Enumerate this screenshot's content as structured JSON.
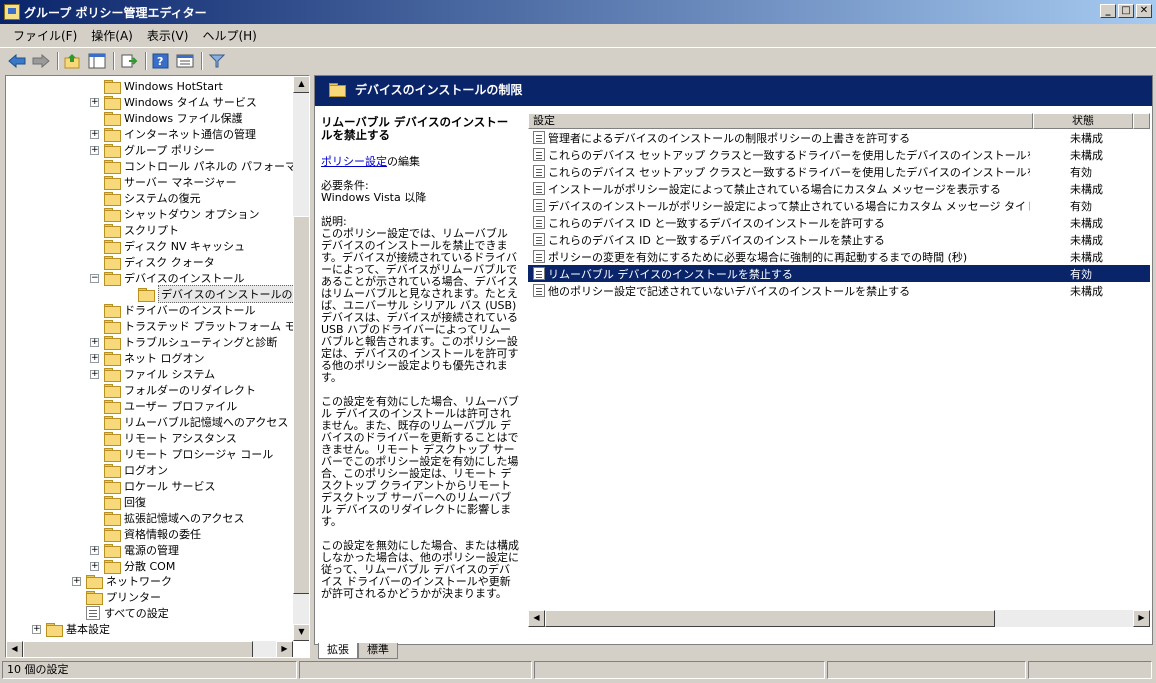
{
  "window": {
    "title": "グループ ポリシー管理エディター",
    "controls": [
      "_",
      "□",
      "✕"
    ]
  },
  "menu": [
    "ファイル(F)",
    "操作(A)",
    "表示(V)",
    "ヘルプ(H)"
  ],
  "tree": {
    "items": [
      {
        "label": "Windows HotStart",
        "expander": ""
      },
      {
        "label": "Windows タイム サービス",
        "expander": "+"
      },
      {
        "label": "Windows ファイル保護",
        "expander": ""
      },
      {
        "label": "インターネット通信の管理",
        "expander": "+"
      },
      {
        "label": "グループ ポリシー",
        "expander": "+"
      },
      {
        "label": "コントロール パネルの パフォーマンス",
        "expander": ""
      },
      {
        "label": "サーバー マネージャー",
        "expander": ""
      },
      {
        "label": "システムの復元",
        "expander": ""
      },
      {
        "label": "シャットダウン オプション",
        "expander": ""
      },
      {
        "label": "スクリプト",
        "expander": ""
      },
      {
        "label": "ディスク NV キャッシュ",
        "expander": ""
      },
      {
        "label": "ディスク クォータ",
        "expander": ""
      },
      {
        "label": "デバイスのインストール",
        "expander": "−"
      },
      {
        "label": "デバイスのインストールの制限",
        "expander": "",
        "child": true,
        "selected": true
      },
      {
        "label": "ドライバーのインストール",
        "expander": ""
      },
      {
        "label": "トラステッド プラットフォーム モジュール",
        "expander": ""
      },
      {
        "label": "トラブルシューティングと診断",
        "expander": "+"
      },
      {
        "label": "ネット ログオン",
        "expander": "+"
      },
      {
        "label": "ファイル システム",
        "expander": "+"
      },
      {
        "label": "フォルダーのリダイレクト",
        "expander": ""
      },
      {
        "label": "ユーザー プロファイル",
        "expander": ""
      },
      {
        "label": "リムーバブル記憶域へのアクセス",
        "expander": ""
      },
      {
        "label": "リモート アシスタンス",
        "expander": ""
      },
      {
        "label": "リモート プロシージャ コール",
        "expander": ""
      },
      {
        "label": "ログオン",
        "expander": ""
      },
      {
        "label": "ロケール サービス",
        "expander": ""
      },
      {
        "label": "回復",
        "expander": ""
      },
      {
        "label": "拡張記憶域へのアクセス",
        "expander": ""
      },
      {
        "label": "資格情報の委任",
        "expander": ""
      },
      {
        "label": "電源の管理",
        "expander": "+"
      },
      {
        "label": "分散 COM",
        "expander": "+"
      }
    ],
    "network": "ネットワーク",
    "printer": "プリンター",
    "all_settings": "すべての設定",
    "basic_settings": "基本設定"
  },
  "right": {
    "header": "デバイスのインストールの制限",
    "desc_title": "リムーバブル デバイスのインストールを禁止する",
    "edit_link": "ポリシー設定",
    "edit_suffix": "の編集",
    "requirements_label": "必要条件:",
    "requirements_value": "Windows Vista 以降",
    "description_label": "説明:",
    "description_p1": "このポリシー設定では、リムーバブル デバイスのインストールを禁止できます。デバイスが接続されているドライバーによって、デバイスがリムーバブルであることが示されている場合、デバイスはリムーバブルと見なされます。たとえば、ユニバーサル シリアル バス (USB) デバイスは、デバイスが接続されている USB ハブのドライバーによってリムーバブルと報告されます。このポリシー設定は、デバイスのインストールを許可する他のポリシー設定よりも優先されます。",
    "description_p2": "この設定を有効にした場合、リムーバブル デバイスのインストールは許可されません。また、既存のリムーバブル デバイスのドライバーを更新することはできません。リモート デスクトップ サーバーでこのポリシー設定を有効にした場合、このポリシー設定は、リモート デスクトップ クライアントからリモート デスクトップ サーバーへのリムーバブル デバイスのリダイレクトに影響します。",
    "description_p3": "この設定を無効にした場合、または構成しなかった場合は、他のポリシー設定に従って、リムーバブル デバイスのデバイス ドライバーのインストールや更新が許可されるかどうかが決まります。",
    "columns": {
      "setting": "設定",
      "state": "状態"
    },
    "rows": [
      {
        "name": "管理者によるデバイスのインストールの制限ポリシーの上書きを許可する",
        "state": "未構成"
      },
      {
        "name": "これらのデバイス セットアップ クラスと一致するドライバーを使用したデバイスのインストールを許可する",
        "state": "未構成"
      },
      {
        "name": "これらのデバイス セットアップ クラスと一致するドライバーを使用したデバイスのインストールを禁止する",
        "state": "有効"
      },
      {
        "name": "インストールがポリシー設定によって禁止されている場合にカスタム メッセージを表示する",
        "state": "未構成"
      },
      {
        "name": "デバイスのインストールがポリシー設定によって禁止されている場合にカスタム メッセージ タイトルを表示...",
        "state": "有効"
      },
      {
        "name": "これらのデバイス ID と一致するデバイスのインストールを許可する",
        "state": "未構成"
      },
      {
        "name": "これらのデバイス ID と一致するデバイスのインストールを禁止する",
        "state": "未構成"
      },
      {
        "name": "ポリシーの変更を有効にするために必要な場合に強制的に再起動するまでの時間 (秒)",
        "state": "未構成"
      },
      {
        "name": "リムーバブル デバイスのインストールを禁止する",
        "state": "有効",
        "selected": true
      },
      {
        "name": "他のポリシー設定で記述されていないデバイスのインストールを禁止する",
        "state": "未構成"
      }
    ]
  },
  "tabs": [
    "拡張",
    "標準"
  ],
  "status": {
    "text": "10 個の設定"
  }
}
